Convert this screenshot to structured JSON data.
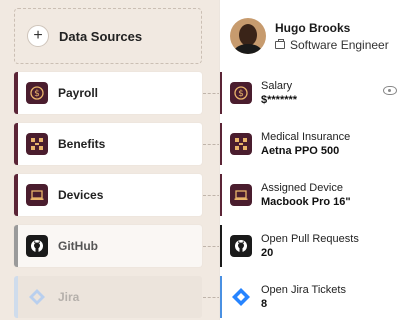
{
  "add_source": {
    "label": "Data Sources"
  },
  "sources": [
    {
      "label": "Payroll",
      "icon": "payroll-dollar-icon"
    },
    {
      "label": "Benefits",
      "icon": "benefits-icon"
    },
    {
      "label": "Devices",
      "icon": "laptop-icon"
    },
    {
      "label": "GitHub",
      "icon": "github-icon"
    },
    {
      "label": "Jira",
      "icon": "jira-icon"
    }
  ],
  "profile": {
    "name": "Hugo Brooks",
    "title": "Software Engineer"
  },
  "fields": [
    {
      "label": "Salary",
      "value": "$*******"
    },
    {
      "label": "Medical Insurance",
      "value": "Aetna PPO 500"
    },
    {
      "label": "Assigned Device",
      "value": "Macbook Pro 16\""
    },
    {
      "label": "Open Pull Requests",
      "value": "20"
    },
    {
      "label": "Open Jira Tickets",
      "value": "8"
    }
  ],
  "colors": {
    "maroon": "#4a1d2e",
    "background": "#f1e9e1",
    "jira_blue": "#2684ff"
  }
}
